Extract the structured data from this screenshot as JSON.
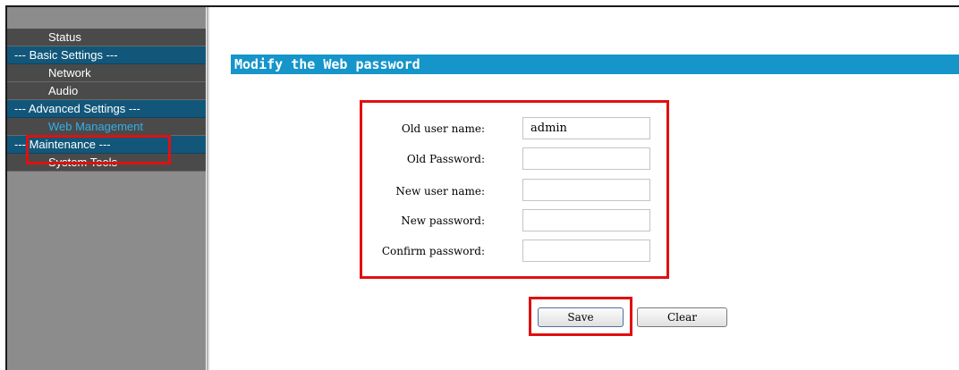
{
  "sidebar": {
    "items": [
      {
        "label": "Status",
        "type": "item"
      },
      {
        "label": "--- Basic Settings ---",
        "type": "header"
      },
      {
        "label": "Network",
        "type": "item"
      },
      {
        "label": "Audio",
        "type": "item"
      },
      {
        "label": "--- Advanced Settings ---",
        "type": "header"
      },
      {
        "label": "Web Management",
        "type": "item",
        "active": true
      },
      {
        "label": "--- Maintenance ---",
        "type": "header"
      },
      {
        "label": "System Tools",
        "type": "item"
      }
    ]
  },
  "main": {
    "title": "Modify the Web password",
    "fields": [
      {
        "label": "Old user name:",
        "value": "admin"
      },
      {
        "label": "Old Password:",
        "value": ""
      },
      {
        "label": "New user name:",
        "value": ""
      },
      {
        "label": "New password:",
        "value": ""
      },
      {
        "label": "Confirm password:",
        "value": ""
      }
    ],
    "save_label": "Save",
    "clear_label": "Clear"
  },
  "colors": {
    "title_bar": "#1595c9",
    "menu_header": "#12577a",
    "active_item": "#2fb0ea",
    "highlight": "#e01010"
  }
}
